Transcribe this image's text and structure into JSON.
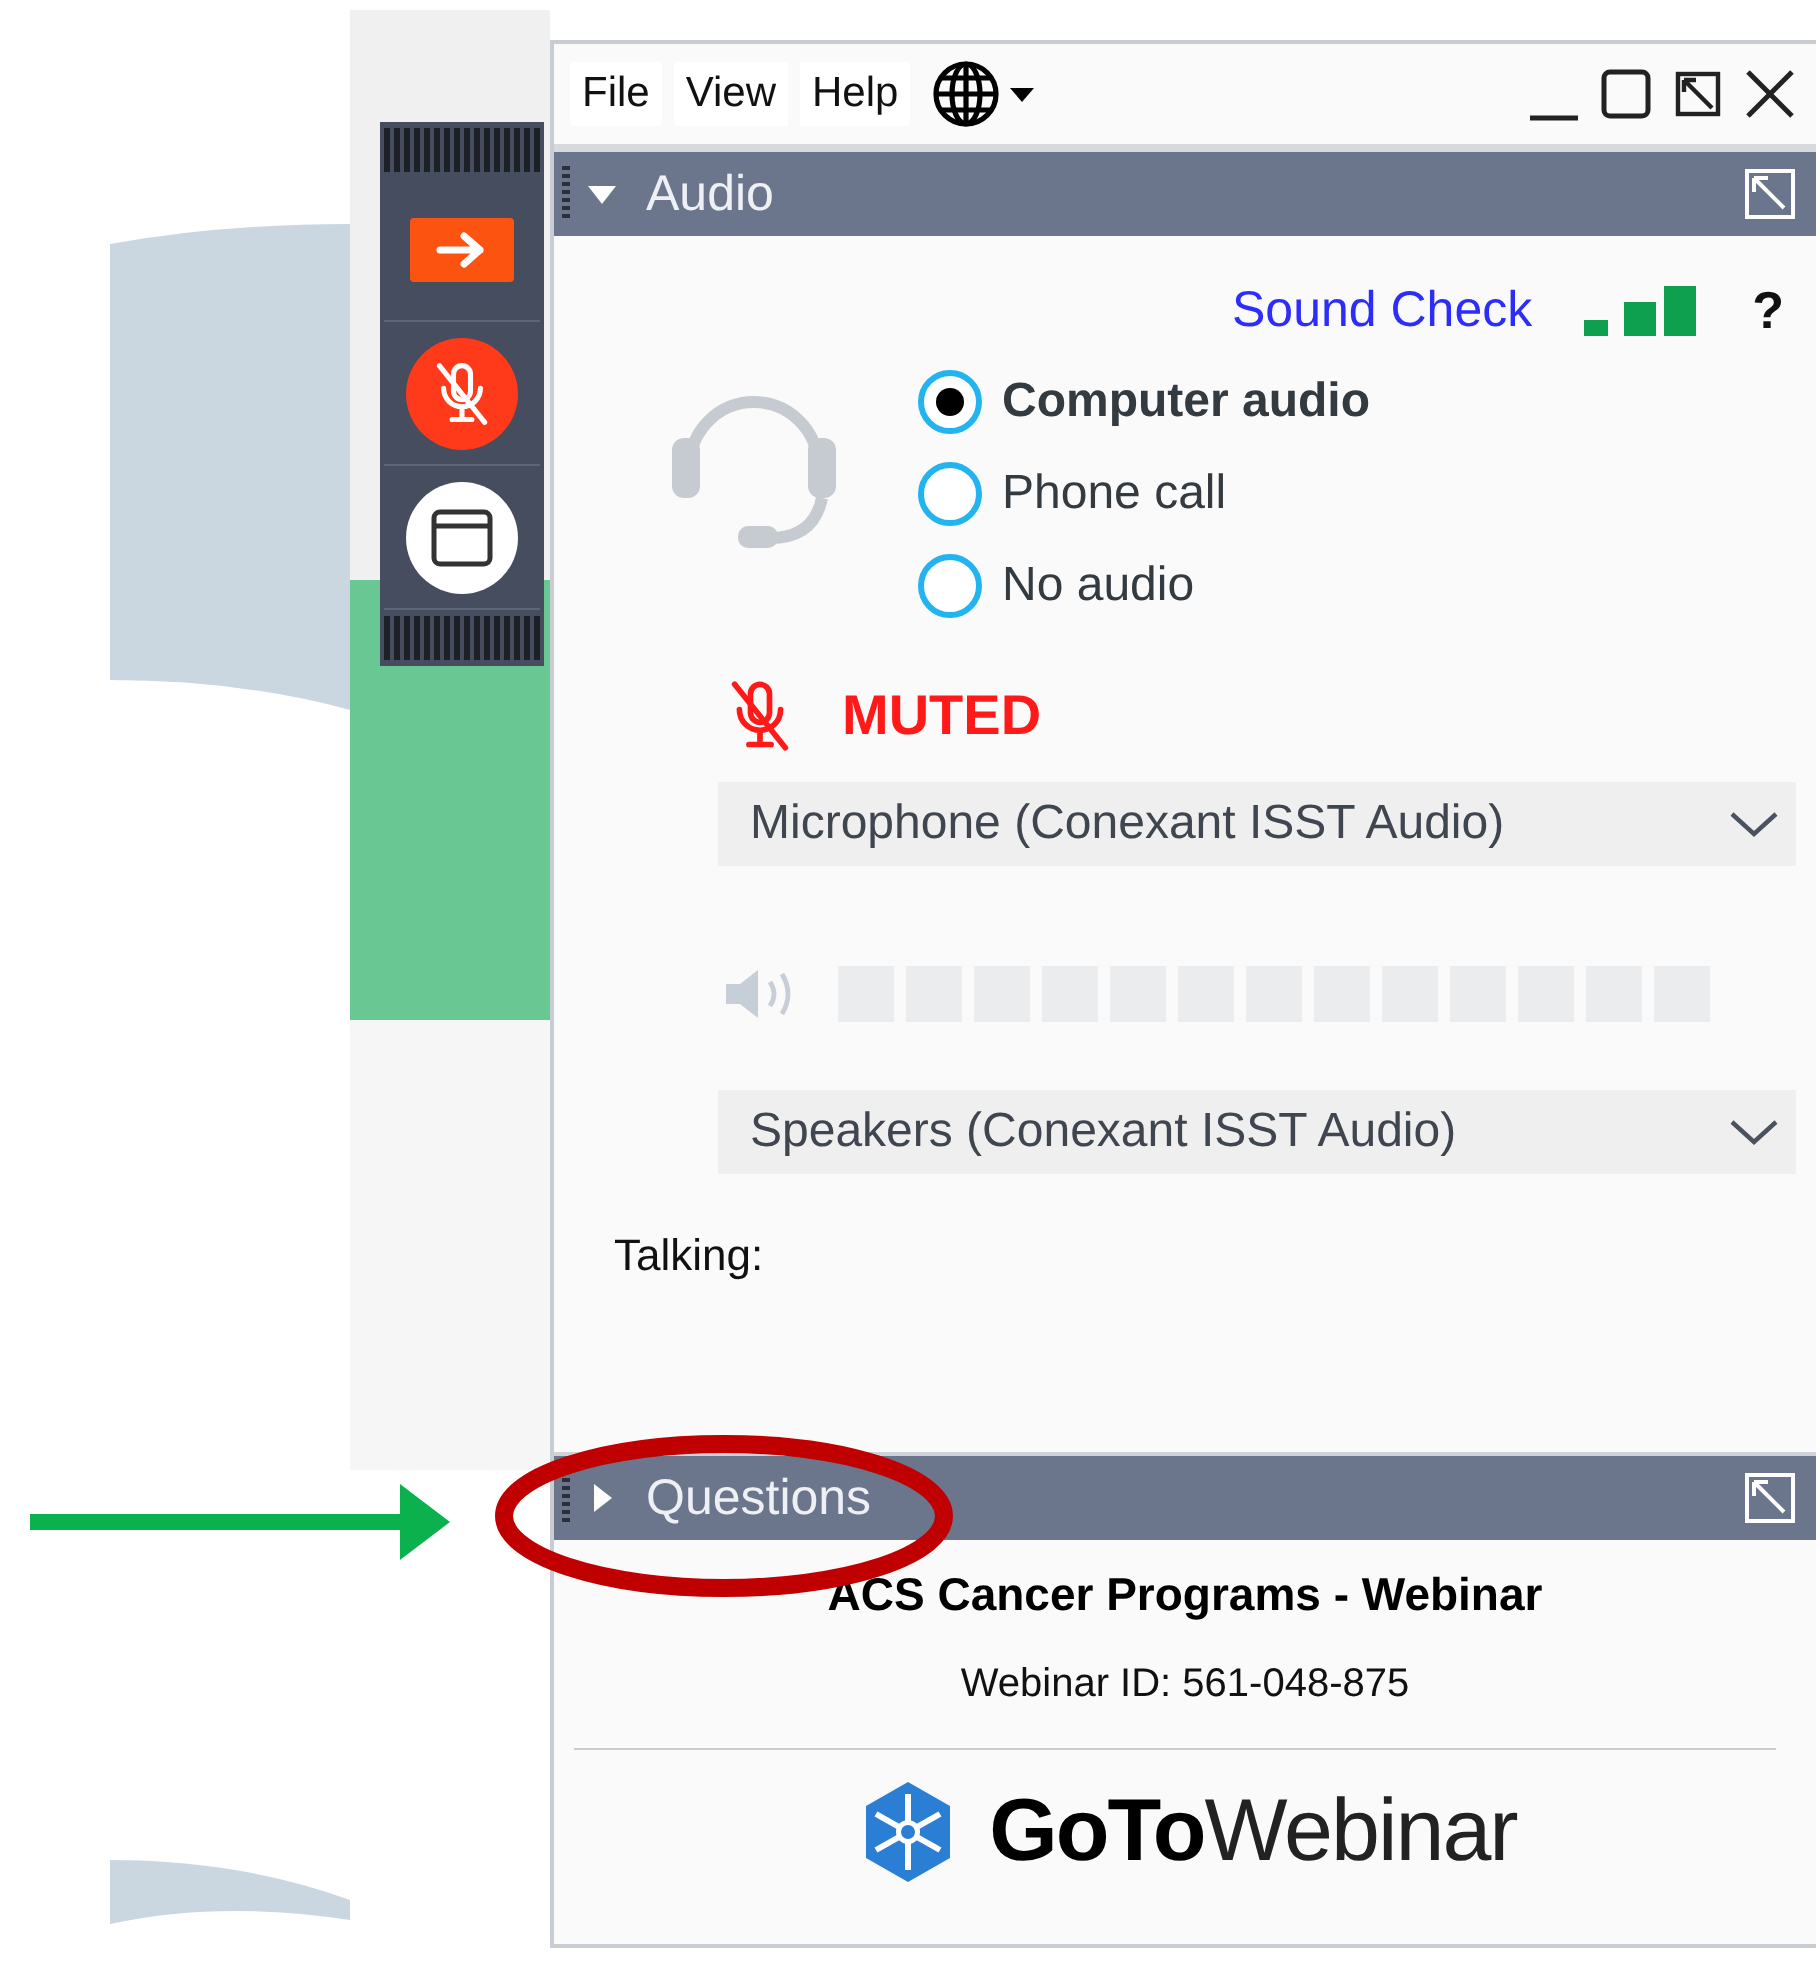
{
  "menu": [
    "File",
    "View",
    "Help"
  ],
  "audio_section": {
    "title": "Audio",
    "expanded": true
  },
  "sound_check": {
    "link": "Sound Check",
    "help": "?"
  },
  "audio_options": [
    {
      "label": "Computer audio",
      "selected": true
    },
    {
      "label": "Phone call",
      "selected": false
    },
    {
      "label": "No audio",
      "selected": false
    }
  ],
  "mic_status": {
    "label": "MUTED",
    "muted": true
  },
  "microphone": {
    "value": "Microphone (Conexant ISST Audio)"
  },
  "speaker_meter": {
    "level": 0
  },
  "speakers": {
    "value": "Speakers (Conexant ISST Audio)"
  },
  "talking_label": "Talking:",
  "questions_section": {
    "title": "Questions",
    "expanded": false
  },
  "webinar": {
    "title": "ACS Cancer Programs - Webinar",
    "id": "Webinar ID: 561-048-875"
  },
  "logo": "**GoTo**Webinar"
}
